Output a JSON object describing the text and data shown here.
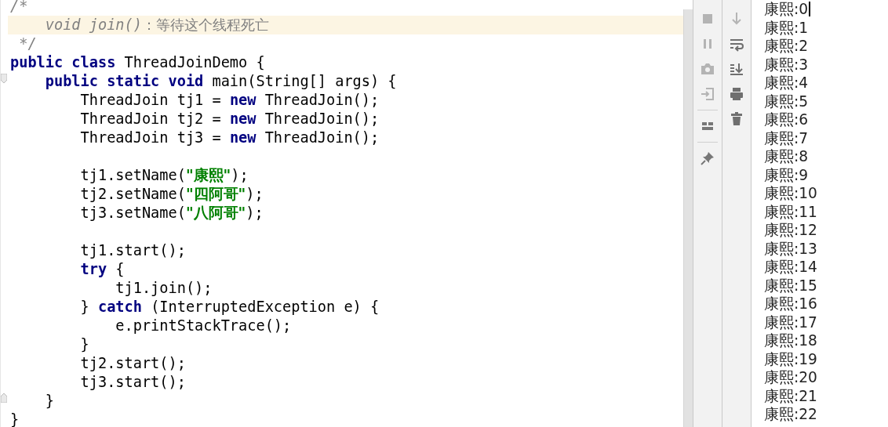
{
  "editor": {
    "lines": [
      {
        "current": false,
        "tokens": [
          {
            "kind": "comment",
            "text": "/*"
          }
        ]
      },
      {
        "current": true,
        "tokens": [
          {
            "kind": "comment",
            "text": "    void join()"
          },
          {
            "kind": "comment_cn",
            "text": "：等待这个线程死亡"
          }
        ]
      },
      {
        "current": false,
        "tokens": [
          {
            "kind": "comment",
            "text": " */"
          }
        ]
      },
      {
        "current": false,
        "tokens": [
          {
            "kind": "keyword",
            "text": "public class "
          },
          {
            "kind": "plain",
            "text": "ThreadJoinDemo {"
          }
        ]
      },
      {
        "current": false,
        "tokens": [
          {
            "kind": "keyword",
            "text": "    public static void "
          },
          {
            "kind": "plain",
            "text": "main(String[] args) {"
          }
        ]
      },
      {
        "current": false,
        "tokens": [
          {
            "kind": "plain",
            "text": "        ThreadJoin tj1 = "
          },
          {
            "kind": "keyword",
            "text": "new "
          },
          {
            "kind": "plain",
            "text": "ThreadJoin();"
          }
        ]
      },
      {
        "current": false,
        "tokens": [
          {
            "kind": "plain",
            "text": "        ThreadJoin tj2 = "
          },
          {
            "kind": "keyword",
            "text": "new "
          },
          {
            "kind": "plain",
            "text": "ThreadJoin();"
          }
        ]
      },
      {
        "current": false,
        "tokens": [
          {
            "kind": "plain",
            "text": "        ThreadJoin tj3 = "
          },
          {
            "kind": "keyword",
            "text": "new "
          },
          {
            "kind": "plain",
            "text": "ThreadJoin();"
          }
        ]
      },
      {
        "current": false
      },
      {
        "current": false,
        "tokens": [
          {
            "kind": "plain",
            "text": "        tj1.setName("
          },
          {
            "kind": "string",
            "text": "\"康熙\""
          },
          {
            "kind": "plain",
            "text": ");"
          }
        ]
      },
      {
        "current": false,
        "tokens": [
          {
            "kind": "plain",
            "text": "        tj2.setName("
          },
          {
            "kind": "string",
            "text": "\"四阿哥\""
          },
          {
            "kind": "plain",
            "text": ");"
          }
        ]
      },
      {
        "current": false,
        "tokens": [
          {
            "kind": "plain",
            "text": "        tj3.setName("
          },
          {
            "kind": "string",
            "text": "\"八阿哥\""
          },
          {
            "kind": "plain",
            "text": ");"
          }
        ]
      },
      {
        "current": false
      },
      {
        "current": false,
        "tokens": [
          {
            "kind": "plain",
            "text": "        tj1.start();"
          }
        ]
      },
      {
        "current": false,
        "tokens": [
          {
            "kind": "keyword",
            "text": "        try "
          },
          {
            "kind": "plain",
            "text": "{"
          }
        ]
      },
      {
        "current": false,
        "tokens": [
          {
            "kind": "plain",
            "text": "            tj1.join();"
          }
        ]
      },
      {
        "current": false,
        "tokens": [
          {
            "kind": "plain",
            "text": "        } "
          },
          {
            "kind": "keyword",
            "text": "catch "
          },
          {
            "kind": "plain",
            "text": "(InterruptedException e) {"
          }
        ]
      },
      {
        "current": false,
        "tokens": [
          {
            "kind": "plain",
            "text": "            e.printStackTrace();"
          }
        ]
      },
      {
        "current": false,
        "tokens": [
          {
            "kind": "plain",
            "text": "        }"
          }
        ]
      },
      {
        "current": false,
        "tokens": [
          {
            "kind": "plain",
            "text": "        tj2.start();"
          }
        ]
      },
      {
        "current": false,
        "tokens": [
          {
            "kind": "plain",
            "text": "        tj3.start();"
          }
        ]
      },
      {
        "current": false,
        "tokens": [
          {
            "kind": "plain",
            "text": "    }"
          }
        ]
      },
      {
        "current": false,
        "tokens": [
          {
            "kind": "plain",
            "text": "}"
          }
        ]
      }
    ]
  },
  "console": {
    "lines": [
      {
        "text": "康熙:0",
        "caret": true
      },
      {
        "text": "康熙:1",
        "caret": false
      },
      {
        "text": "康熙:2",
        "caret": false
      },
      {
        "text": "康熙:3",
        "caret": false
      },
      {
        "text": "康熙:4",
        "caret": false
      },
      {
        "text": "康熙:5",
        "caret": false
      },
      {
        "text": "康熙:6",
        "caret": false
      },
      {
        "text": "康熙:7",
        "caret": false
      },
      {
        "text": "康熙:8",
        "caret": false
      },
      {
        "text": "康熙:9",
        "caret": false
      },
      {
        "text": "康熙:10",
        "caret": false
      },
      {
        "text": "康熙:11",
        "caret": false
      },
      {
        "text": "康熙:12",
        "caret": false
      },
      {
        "text": "康熙:13",
        "caret": false
      },
      {
        "text": "康熙:14",
        "caret": false
      },
      {
        "text": "康熙:15",
        "caret": false
      },
      {
        "text": "康熙:16",
        "caret": false
      },
      {
        "text": "康熙:17",
        "caret": false
      },
      {
        "text": "康熙:18",
        "caret": false
      },
      {
        "text": "康熙:19",
        "caret": false
      },
      {
        "text": "康熙:20",
        "caret": false
      },
      {
        "text": "康熙:21",
        "caret": false
      },
      {
        "text": "康熙:22",
        "caret": false
      }
    ]
  }
}
